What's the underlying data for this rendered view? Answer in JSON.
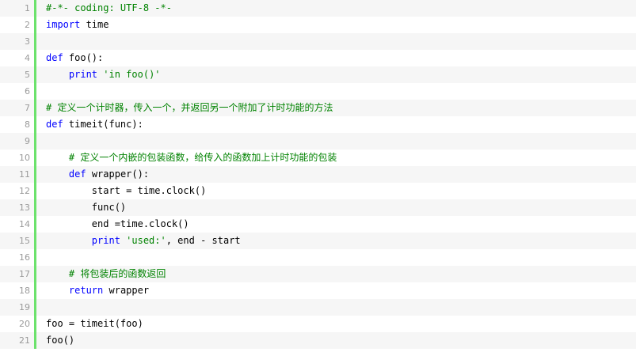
{
  "colors": {
    "keyword": "#0000ff",
    "string": "#008200",
    "comment": "#008200",
    "gutter_border": "#6ce26c",
    "line_number": "#9a9a9a",
    "alt_row_bg": "#f6f6f6"
  },
  "lines": [
    {
      "num": "1",
      "tokens": [
        {
          "t": "cmt",
          "v": "#-*- coding: UTF-8 -*-"
        }
      ]
    },
    {
      "num": "2",
      "tokens": [
        {
          "t": "kw",
          "v": "import"
        },
        {
          "t": "plain",
          "v": " time"
        }
      ]
    },
    {
      "num": "3",
      "tokens": []
    },
    {
      "num": "4",
      "tokens": [
        {
          "t": "kw",
          "v": "def"
        },
        {
          "t": "plain",
          "v": " foo():"
        }
      ]
    },
    {
      "num": "5",
      "tokens": [
        {
          "t": "plain",
          "v": "    "
        },
        {
          "t": "kw",
          "v": "print"
        },
        {
          "t": "plain",
          "v": " "
        },
        {
          "t": "str",
          "v": "'in foo()'"
        }
      ]
    },
    {
      "num": "6",
      "tokens": []
    },
    {
      "num": "7",
      "tokens": [
        {
          "t": "cmt",
          "v": "# 定义一个计时器，传入一个，并返回另一个附加了计时功能的方法"
        }
      ]
    },
    {
      "num": "8",
      "tokens": [
        {
          "t": "kw",
          "v": "def"
        },
        {
          "t": "plain",
          "v": " timeit(func):"
        }
      ]
    },
    {
      "num": "9",
      "tokens": []
    },
    {
      "num": "10",
      "tokens": [
        {
          "t": "plain",
          "v": "    "
        },
        {
          "t": "cmt",
          "v": "# 定义一个内嵌的包装函数，给传入的函数加上计时功能的包装"
        }
      ]
    },
    {
      "num": "11",
      "tokens": [
        {
          "t": "plain",
          "v": "    "
        },
        {
          "t": "kw",
          "v": "def"
        },
        {
          "t": "plain",
          "v": " wrapper():"
        }
      ]
    },
    {
      "num": "12",
      "tokens": [
        {
          "t": "plain",
          "v": "        start = time.clock()"
        }
      ]
    },
    {
      "num": "13",
      "tokens": [
        {
          "t": "plain",
          "v": "        func()"
        }
      ]
    },
    {
      "num": "14",
      "tokens": [
        {
          "t": "plain",
          "v": "        end =time.clock()"
        }
      ]
    },
    {
      "num": "15",
      "tokens": [
        {
          "t": "plain",
          "v": "        "
        },
        {
          "t": "kw",
          "v": "print"
        },
        {
          "t": "plain",
          "v": " "
        },
        {
          "t": "str",
          "v": "'used:'"
        },
        {
          "t": "plain",
          "v": ", end - start"
        }
      ]
    },
    {
      "num": "16",
      "tokens": []
    },
    {
      "num": "17",
      "tokens": [
        {
          "t": "plain",
          "v": "    "
        },
        {
          "t": "cmt",
          "v": "# 将包装后的函数返回"
        }
      ]
    },
    {
      "num": "18",
      "tokens": [
        {
          "t": "plain",
          "v": "    "
        },
        {
          "t": "kw",
          "v": "return"
        },
        {
          "t": "plain",
          "v": " wrapper"
        }
      ]
    },
    {
      "num": "19",
      "tokens": []
    },
    {
      "num": "20",
      "tokens": [
        {
          "t": "plain",
          "v": "foo = timeit(foo)"
        }
      ]
    },
    {
      "num": "21",
      "tokens": [
        {
          "t": "plain",
          "v": "foo()"
        }
      ]
    }
  ]
}
